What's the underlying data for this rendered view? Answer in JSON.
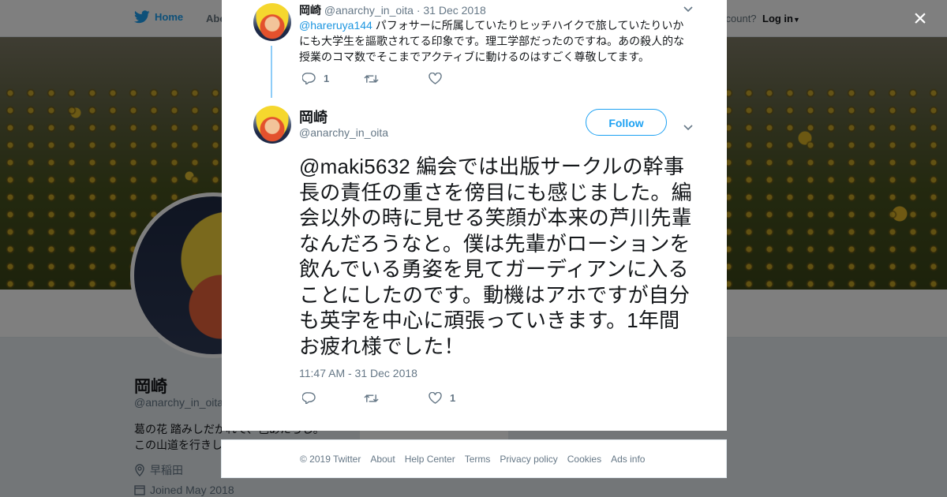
{
  "nav": {
    "home_label": "Home",
    "about_label": "Abo",
    "account_prompt": "ccount?",
    "login_label": "Log in"
  },
  "profile": {
    "name": "岡崎",
    "handle": "@anarchy_in_oita",
    "bio": "葛の花 踏みしだかれて、色あたらし。この山道を行きし",
    "location": "早稲田",
    "joined": "Joined May 2018"
  },
  "modal": {
    "close_label": "×",
    "parent_tweet": {
      "name": "岡崎",
      "handle": "@anarchy_in_oita",
      "date": "· 31 Dec 2018",
      "mention": "@hareruya144",
      "text": " パフォサーに所属していたりヒッチハイクで旅していたりいかにも大学生を謳歌されてる印象です。理工学部だったのですね。あの殺人的な授業のコマ数でそこまでアクティブに動けるのはすごく尊敬してます。",
      "reply_count": "1",
      "retweet_count": "",
      "like_count": ""
    },
    "main_tweet": {
      "name": "岡崎",
      "handle": "@anarchy_in_oita",
      "follow_label": "Follow",
      "text": "@maki5632 編会では出版サークルの幹事長の責任の重さを傍目にも感じました。編会以外の時に見せる笑顔が本来の芦川先輩なんだろうなと。僕は先輩がローションを飲んでいる勇姿を見てガーディアンに入ることにしたのです。動機はアホですが自分も英字を中心に頑張っていきます。1年間お疲れ様でした！",
      "timestamp": "11:47 AM - 31 Dec 2018",
      "reply_count": "",
      "retweet_count": "",
      "like_count": "1"
    }
  },
  "footer": {
    "links": [
      "© 2019 Twitter",
      "About",
      "Help Center",
      "Terms",
      "Privacy policy",
      "Cookies",
      "Ads info"
    ]
  },
  "colors": {
    "twitter_blue": "#1da1f2",
    "link_blue": "#1b95e0",
    "thread_line": "#8ecdf8",
    "muted_text": "#657786"
  }
}
